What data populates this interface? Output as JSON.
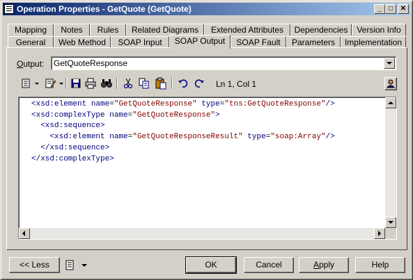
{
  "window": {
    "title": "Operation Properties - GetQuote (GetQuote)",
    "minimize": "_",
    "maximize": "□",
    "close": "✕"
  },
  "tabs_top": [
    "Mapping",
    "Notes",
    "Rules",
    "Related Diagrams",
    "Extended Attributes",
    "Dependencies",
    "Version Info"
  ],
  "tabs_bottom": [
    "General",
    "Web Method",
    "SOAP Input",
    "SOAP Output",
    "SOAP Fault",
    "Parameters",
    "Implementation"
  ],
  "active_tab": "SOAP Output",
  "output": {
    "label_prefix": "O",
    "label_rest": "utput:",
    "value": "GetQuoteResponse"
  },
  "toolbar": {
    "icons": [
      "properties-menu-icon",
      "edit-menu-icon",
      "save-icon",
      "print-icon",
      "find-icon",
      "cut-icon",
      "copy-icon",
      "paste-icon",
      "undo-icon",
      "redo-icon"
    ],
    "position": "Ln 1, Col 1"
  },
  "code_lines": [
    {
      "indent": "",
      "tag": "<xsd:element",
      "attrs": [
        {
          "name": "name",
          "value": "\"GetQuoteResponse\""
        },
        {
          "name": "type",
          "value": "\"tns:GetQuoteResponse\""
        }
      ],
      "close": "/>"
    },
    {
      "indent": "",
      "tag": "<xsd:complexType",
      "attrs": [
        {
          "name": "name",
          "value": "\"GetQuoteResponse\""
        }
      ],
      "close": ">"
    },
    {
      "indent": "  ",
      "tag": "<xsd:sequence",
      "attrs": [],
      "close": ">"
    },
    {
      "indent": "    ",
      "tag": "<xsd:element",
      "attrs": [
        {
          "name": "name",
          "value": "\"GetQuoteResponseResult\""
        },
        {
          "name": "type",
          "value": "\"soap:Array\""
        }
      ],
      "close": "/>"
    },
    {
      "indent": "  ",
      "tag": "</xsd:sequence",
      "attrs": [],
      "close": ">"
    },
    {
      "indent": "",
      "tag": "</xsd:complexType",
      "attrs": [],
      "close": ">"
    }
  ],
  "buttons": {
    "less": "<< Less",
    "ok": "OK",
    "cancel": "Cancel",
    "apply_prefix": "A",
    "apply_rest": "pply",
    "help": "Help"
  },
  "colors": {
    "title_start": "#0a246a",
    "title_end": "#a6caf0",
    "face": "#d4d0c8",
    "tag": "#000080",
    "value": "#800000"
  }
}
